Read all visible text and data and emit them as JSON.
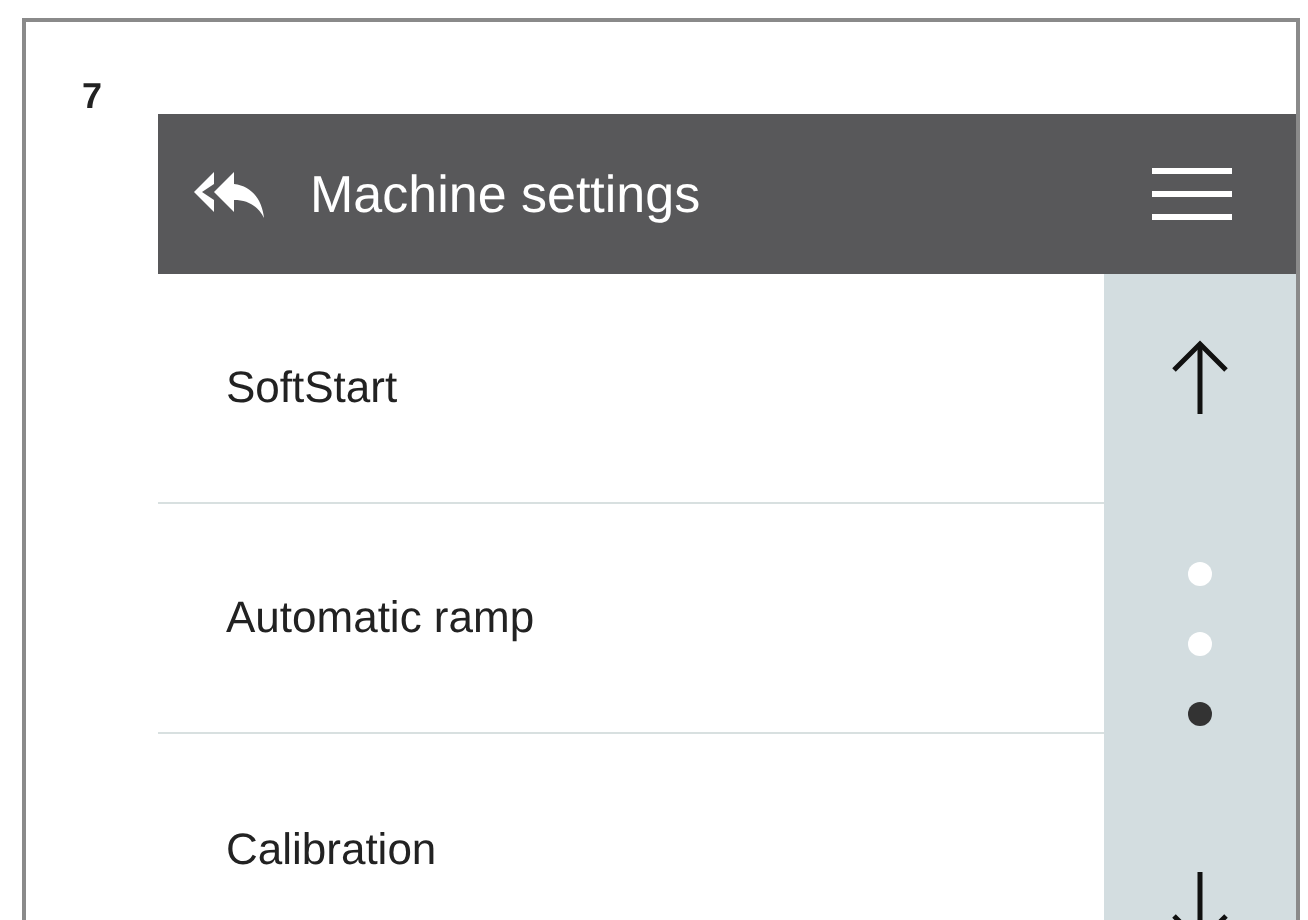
{
  "figure_label": "7",
  "header": {
    "title": "Machine settings"
  },
  "menu_items": [
    {
      "label": "SoftStart"
    },
    {
      "label": "Automatic ramp"
    },
    {
      "label": "Calibration"
    }
  ],
  "pager": [
    {
      "selected": false
    },
    {
      "selected": false
    },
    {
      "selected": true
    }
  ]
}
